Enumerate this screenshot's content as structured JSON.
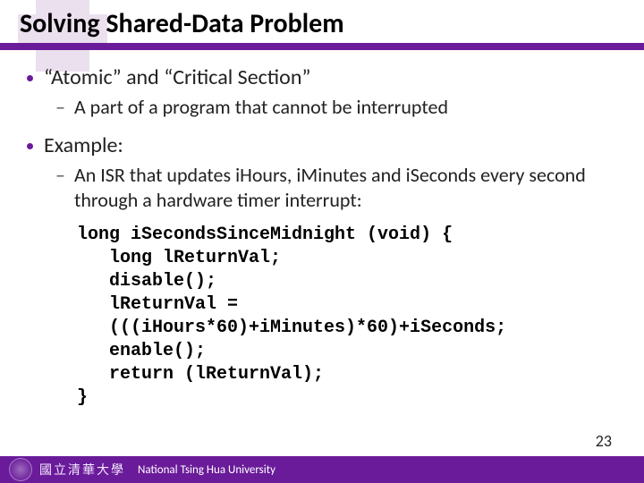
{
  "title": "Solving Shared-Data Problem",
  "bullets": {
    "b1": "“Atomic” and “Critical Section”",
    "b1_sub": "A part of a program that cannot be interrupted",
    "b2": "Example:",
    "b2_sub": "An ISR that updates iHours, iMinutes and iSeconds every second through a hardware timer interrupt:"
  },
  "code": {
    "l1": "long iSecondsSinceMidnight (void) {",
    "l2": "   long lReturnVal;",
    "l3": "   disable();",
    "l4": "   lReturnVal =",
    "l5": "   (((iHours*60)+iMinutes)*60)+iSeconds;",
    "l6": "   enable();",
    "l7": "   return (lReturnVal);",
    "l8": "}"
  },
  "footer": {
    "cn": "國立清華大學",
    "en": "National Tsing Hua University"
  },
  "page_number": "23"
}
